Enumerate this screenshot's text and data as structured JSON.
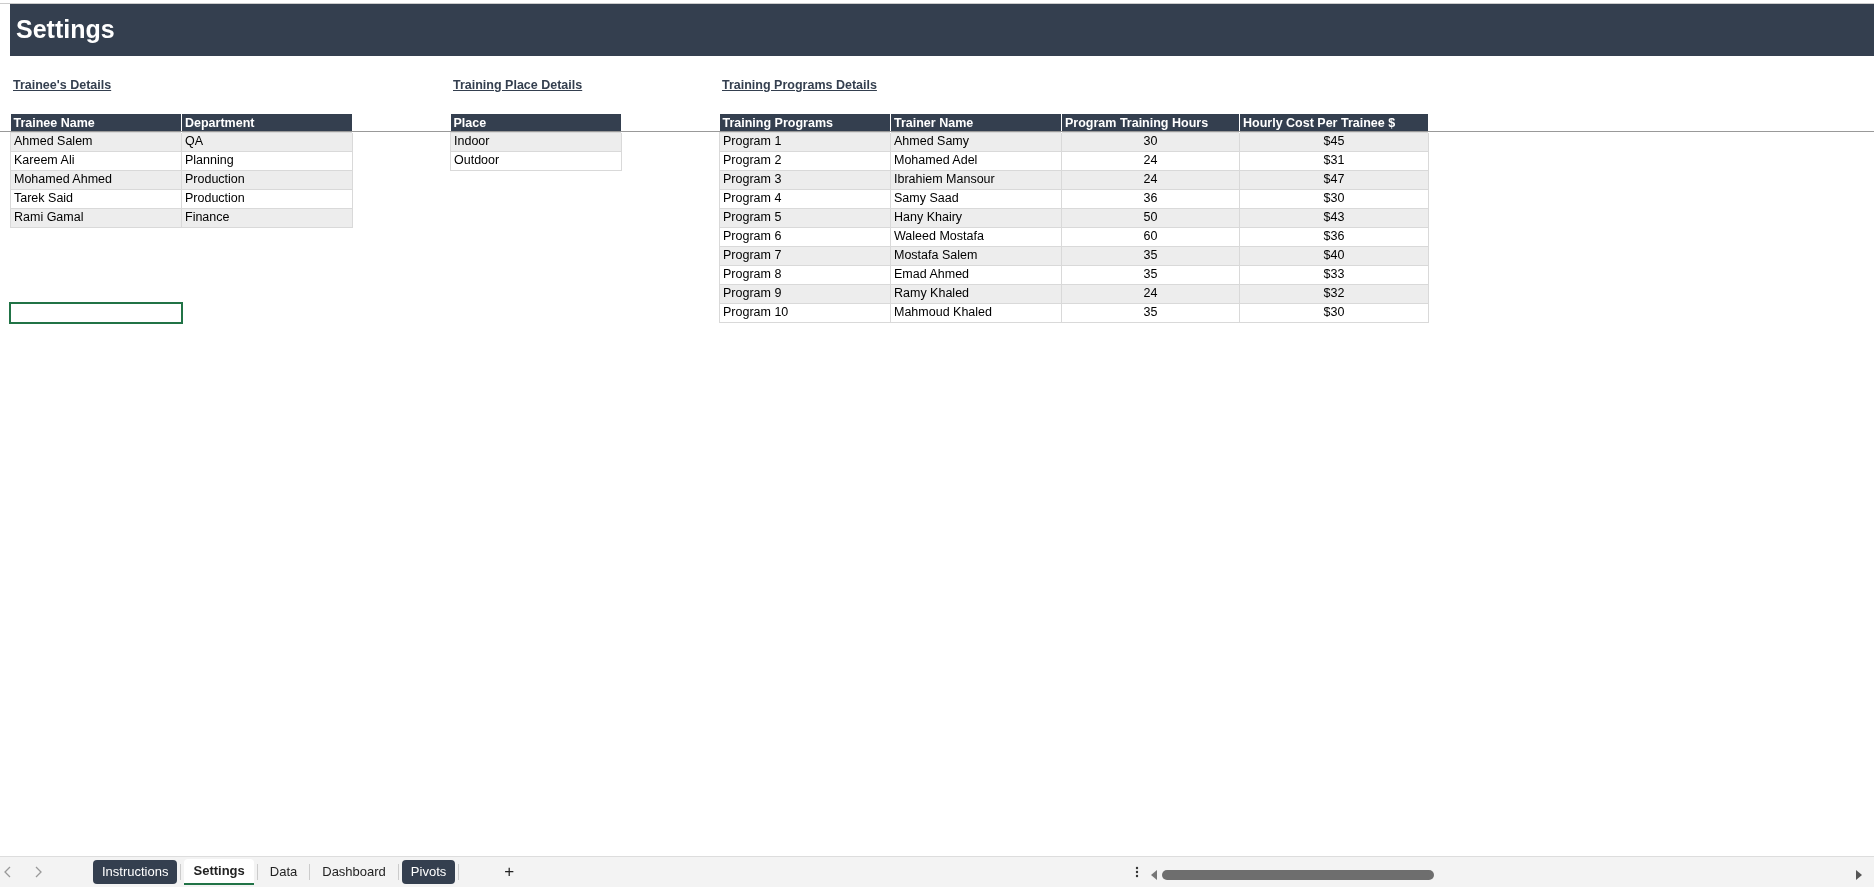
{
  "banner": {
    "title": "Settings"
  },
  "trainees": {
    "title": "Trainee's Details",
    "columns": [
      "Trainee Name",
      "Department"
    ],
    "rows": [
      [
        "Ahmed Salem",
        "QA"
      ],
      [
        "Kareem Ali",
        "Planning"
      ],
      [
        "Mohamed Ahmed",
        "Production"
      ],
      [
        "Tarek Said",
        "Production"
      ],
      [
        "Rami Gamal",
        "Finance"
      ]
    ]
  },
  "places": {
    "title": "Training Place Details",
    "columns": [
      "Place"
    ],
    "rows": [
      [
        "Indoor"
      ],
      [
        "Outdoor"
      ]
    ]
  },
  "programs": {
    "title": "Training Programs Details",
    "columns": [
      "Training Programs",
      "Trainer Name",
      "Program Training Hours",
      "Hourly Cost Per Trainee $"
    ],
    "rows": [
      [
        "Program 1",
        "Ahmed Samy",
        "30",
        "$45"
      ],
      [
        "Program 2",
        "Mohamed Adel",
        "24",
        "$31"
      ],
      [
        "Program 3",
        "Ibrahiem Mansour",
        "24",
        "$47"
      ],
      [
        "Program 4",
        "Samy Saad",
        "36",
        "$30"
      ],
      [
        "Program 5",
        "Hany Khairy",
        "50",
        "$43"
      ],
      [
        "Program 6",
        "Waleed Mostafa",
        "60",
        "$36"
      ],
      [
        "Program 7",
        "Mostafa Salem",
        "35",
        "$40"
      ],
      [
        "Program 8",
        "Emad Ahmed",
        "35",
        "$33"
      ],
      [
        "Program 9",
        "Ramy Khaled",
        "24",
        "$32"
      ],
      [
        "Program 10",
        "Mahmoud Khaled",
        "35",
        "$30"
      ]
    ]
  },
  "sheet_tabs": [
    {
      "label": "Instructions",
      "selected": false,
      "color": "#343f4f"
    },
    {
      "label": "Settings",
      "selected": true
    },
    {
      "label": "Data",
      "selected": false
    },
    {
      "label": "Dashboard",
      "selected": false
    },
    {
      "label": "Pivots",
      "selected": false,
      "color": "#343f4f"
    }
  ],
  "add_sheet": "+"
}
